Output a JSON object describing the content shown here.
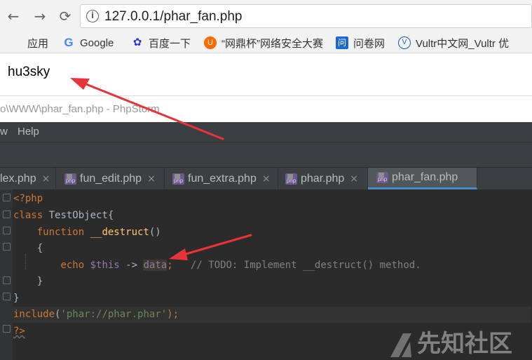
{
  "browser": {
    "nav": {
      "back": "←",
      "forward": "→",
      "reload": "⟳"
    },
    "url": "127.0.0.1/phar_fan.php",
    "bookmarks": [
      {
        "label": "应用",
        "icon": "apps-grid-icon"
      },
      {
        "label": "Google",
        "icon": "google-icon"
      },
      {
        "label": "百度一下",
        "icon": "baidu-paw-icon"
      },
      {
        "label": "“网鼎杯”网络安全大赛",
        "icon": "wangding-icon"
      },
      {
        "label": "问卷网",
        "icon": "wenjuan-icon"
      },
      {
        "label": "Vultr中文网_Vultr 优",
        "icon": "vultr-icon"
      }
    ],
    "page_output": "hu3sky"
  },
  "ide": {
    "title": "o\\WWW\\phar_fan.php - PhpStorm",
    "menu": [
      "w",
      "Help"
    ],
    "tabs": [
      {
        "label": "lex.php",
        "active": false
      },
      {
        "label": "fun_edit.php",
        "active": false
      },
      {
        "label": "fun_extra.php",
        "active": false
      },
      {
        "label": "phar.php",
        "active": false
      },
      {
        "label": "phar_fan.php",
        "active": true
      }
    ],
    "tab_icon_text": "php",
    "close_glyph": "×",
    "code": {
      "l1_tag": "<?php",
      "l2_kw": "class",
      "l2_name": " TestObject{",
      "l3_kw": "function",
      "l3_fn": " __destruct",
      "l3_paren": "()",
      "l4": "{",
      "l5_kw": "echo",
      "l5_var": "$this",
      "l5_arrow": " -> ",
      "l5_prop": "data",
      "l5_semi": ";",
      "l5_comment": "// TODO: Implement __destruct() method.",
      "l6": "}",
      "l7": "}",
      "l8_kw": "include",
      "l8_open": "(",
      "l8_str": "'phar://phar.phar'",
      "l8_close": ");",
      "l9_tag": "?>"
    }
  },
  "watermark": "先知社区",
  "colors": {
    "accent_arrow": "#e8333a",
    "tab_active_underline": "#4a88c7"
  }
}
